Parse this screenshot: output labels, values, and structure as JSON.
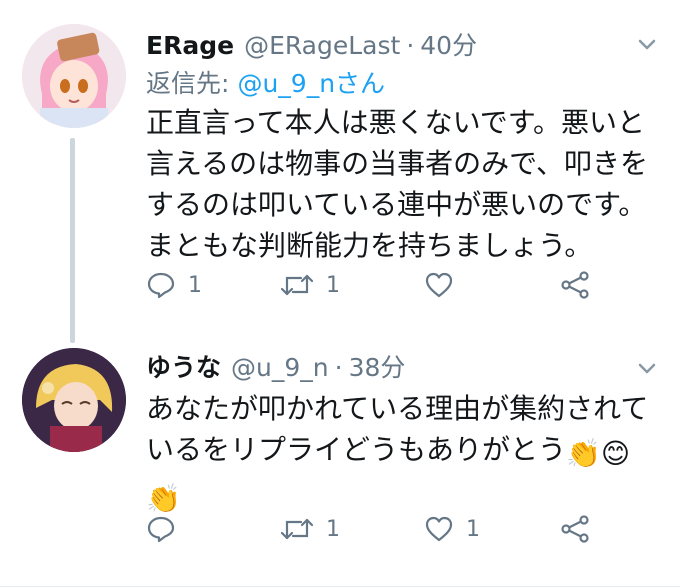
{
  "tweet1": {
    "name": "ERage",
    "handle": "@ERageLast",
    "separator": "·",
    "time": "40分",
    "reply_prefix": "返信先:",
    "reply_link": "@u_9_nさん",
    "text_lines": [
      "正直言って本人は悪くないです。悪いと",
      "言えるのは物事の当事者のみで、叩きを",
      "するのは叩いている連中が悪いのです。",
      "まともな判断能力を持ちましょう。"
    ],
    "reply_count": "1",
    "retweet_count": "1",
    "like_count": ""
  },
  "tweet2": {
    "name": "ゆうな",
    "handle": "@u_9_n",
    "separator": "·",
    "time": "38分",
    "text_lines": [
      "あなたが叩かれている理由が集約されて",
      "いるをリプライどうもありがとう"
    ],
    "emoji_line2": [
      "👏",
      "😊"
    ],
    "emoji_line3": [
      "👏"
    ],
    "reply_count": "",
    "retweet_count": "1",
    "like_count": "1"
  },
  "colors": {
    "text": "#14171a",
    "secondary": "#657786",
    "link": "#1da1f2",
    "thread_line": "#ccd6dd"
  },
  "icons": [
    "reply-icon",
    "retweet-icon",
    "like-icon",
    "share-icon",
    "chevron-down-icon"
  ]
}
